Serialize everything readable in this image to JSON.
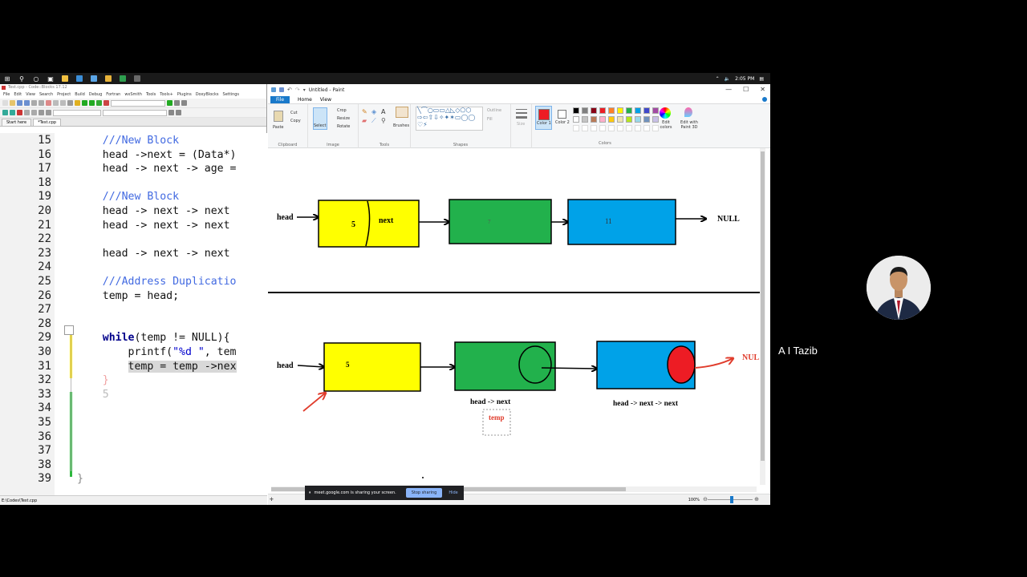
{
  "taskbar": {
    "clock": "2:05 PM"
  },
  "codeblocks": {
    "title": "Test.cpp - Code::Blocks 17.12",
    "menu": [
      "File",
      "Edit",
      "View",
      "Search",
      "Project",
      "Build",
      "Debug",
      "Fortran",
      "wxSmith",
      "Tools",
      "Tools+",
      "Plugins",
      "DoxyBlocks",
      "Settings"
    ],
    "tabs": [
      "Start here",
      "*Test.cpp"
    ],
    "status_path": "E:\\Codes\\Test.cpp",
    "lines": [
      {
        "num": "15",
        "text": "    ///New Block"
      },
      {
        "num": "16",
        "text": "    head ->next = (Data*)"
      },
      {
        "num": "17",
        "text": "    head -> next -> age ="
      },
      {
        "num": "18",
        "text": ""
      },
      {
        "num": "19",
        "text": "    ///New Block"
      },
      {
        "num": "20",
        "text": "    head -> next -> next"
      },
      {
        "num": "21",
        "text": "    head -> next -> next"
      },
      {
        "num": "22",
        "text": ""
      },
      {
        "num": "23",
        "text": "    head -> next -> next"
      },
      {
        "num": "24",
        "text": ""
      },
      {
        "num": "25",
        "text": "    ///Address Duplicatio"
      },
      {
        "num": "26",
        "text": "    temp = head;"
      },
      {
        "num": "27",
        "text": ""
      },
      {
        "num": "28",
        "text": ""
      },
      {
        "num": "29",
        "text": "    while(temp != NULL){"
      },
      {
        "num": "30",
        "text": "        printf(\"%d \", tem"
      },
      {
        "num": "31",
        "text": "        temp = temp ->nex"
      },
      {
        "num": "32",
        "text": "    }"
      },
      {
        "num": "33",
        "text": "    5"
      },
      {
        "num": "34",
        "text": ""
      },
      {
        "num": "35",
        "text": ""
      },
      {
        "num": "36",
        "text": ""
      },
      {
        "num": "37",
        "text": ""
      },
      {
        "num": "38",
        "text": ""
      },
      {
        "num": "39",
        "text": "}"
      }
    ]
  },
  "paint": {
    "title": "Untitled - Paint",
    "ribbon_tabs": [
      "File",
      "Home",
      "View"
    ],
    "groups": {
      "clipboard": "Clipboard",
      "image": "Image",
      "tools": "Tools",
      "shapes": "Shapes",
      "colors": "Colors"
    },
    "buttons": {
      "paste": "Paste",
      "cut": "Cut",
      "copy": "Copy",
      "select": "Select",
      "crop": "Crop",
      "resize": "Resize",
      "rotate": "Rotate",
      "brushes": "Brushes",
      "outline": "Outline",
      "fill": "Fill",
      "size": "Size",
      "color1": "Color 1",
      "color2": "Color 2",
      "edit_colors": "Edit colors",
      "edit_3d": "Edit with Paint 3D"
    },
    "palette": [
      "#000000",
      "#7f7f7f",
      "#880015",
      "#ed1c24",
      "#ff7f27",
      "#fff200",
      "#22b14c",
      "#00a2e8",
      "#3f48cc",
      "#a349a4",
      "#ffffff",
      "#c3c3c3",
      "#b97a57",
      "#ffaec9",
      "#ffc90e",
      "#efe4b0",
      "#b5e61d",
      "#99d9ea",
      "#7092be",
      "#c8bfe7"
    ],
    "zoom": "100%",
    "diagram": {
      "top_head": "head",
      "top_node1_value": "5",
      "top_node1_next": "next",
      "top_node2_value": "7",
      "top_node3_value": "11",
      "top_null": "NULL",
      "bottom_head": "head",
      "bottom_node1_value": "5",
      "bottom_null": "NUL",
      "label_node2": "head -> next",
      "label_node3": "head -> next -> next",
      "label_temp": "temp",
      "colors": {
        "yellow": "#ffff00",
        "green": "#22b14c",
        "blue": "#00a2e8",
        "red": "#ed1c24",
        "red_text": "#e03c2c"
      }
    }
  },
  "meet": {
    "share_text": "meet.google.com is sharing your screen.",
    "stop_label": "Stop sharing",
    "hide_label": "Hide",
    "participant_name": "A I Tazib"
  }
}
